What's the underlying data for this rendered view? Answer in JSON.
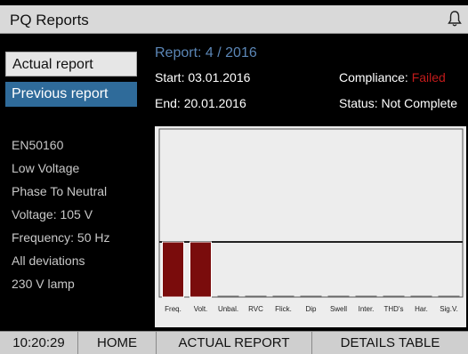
{
  "header": {
    "title": "PQ Reports",
    "icon": "bell-icon"
  },
  "nav": {
    "actual_report": "Actual report",
    "previous_report": "Previous report"
  },
  "settings": [
    "EN50160",
    "Low Voltage",
    "Phase To Neutral",
    "Voltage: 105 V",
    "Frequency: 50 Hz",
    "All deviations",
    "230 V lamp"
  ],
  "report": {
    "title": "Report: 4 / 2016",
    "start": "Start: 03.01.2016",
    "end": "End: 20.01.2016",
    "compliance_label": "Compliance: ",
    "compliance_value": "Failed",
    "status": "Status: Not Complete"
  },
  "chart_data": {
    "type": "bar",
    "categories": [
      "Freq.",
      "Volt.",
      "Unbal.",
      "RVC",
      "Flick.",
      "Dip",
      "Swell",
      "Inter.",
      "THD's",
      "Har.",
      "Sig.V."
    ],
    "values": [
      1,
      1,
      0,
      0,
      0,
      0,
      0,
      0,
      0,
      0,
      0
    ],
    "colors": {
      "bar": "#7a0c0c",
      "plot_bg": "#ededed",
      "limit_line": "#222222"
    }
  },
  "footer": {
    "time": "10:20:29",
    "home": "HOME",
    "actual_report": "ACTUAL REPORT",
    "details_table": "DETAILS TABLE"
  }
}
